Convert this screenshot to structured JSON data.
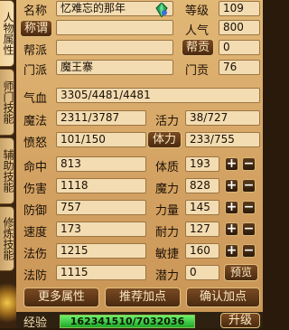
{
  "tabs": [
    "人物属性",
    "师门技能",
    "辅助技能",
    "修炼技能"
  ],
  "profile": {
    "name_label": "名称",
    "name_value": "忆难忘的那年",
    "level_label": "等级",
    "level_value": "109",
    "title_button": "称谓",
    "popularity_label": "人气",
    "popularity_value": "800",
    "guild_label": "帮派",
    "guild_value": "",
    "guild_contrib_button": "帮贡",
    "guild_contrib_value": "0",
    "sect_label": "门派",
    "sect_value": "魔王寨",
    "sect_contrib_label": "门贡",
    "sect_contrib_value": "76"
  },
  "vitals": {
    "hp_label": "气血",
    "hp_value": "3305/4481/4481",
    "mp_label": "魔法",
    "mp_value": "2311/3787",
    "vitality_label": "活力",
    "vitality_value": "38/727",
    "rage_label": "愤怒",
    "rage_value": "101/150",
    "stamina_button": "体力",
    "stamina_value": "233/755"
  },
  "combat": [
    {
      "label": "命中",
      "value": "813"
    },
    {
      "label": "伤害",
      "value": "1118"
    },
    {
      "label": "防御",
      "value": "757"
    },
    {
      "label": "速度",
      "value": "173"
    },
    {
      "label": "法伤",
      "value": "1215"
    },
    {
      "label": "法防",
      "value": "1115"
    }
  ],
  "attributes": [
    {
      "label": "体质",
      "value": "193"
    },
    {
      "label": "魔力",
      "value": "828"
    },
    {
      "label": "力量",
      "value": "145"
    },
    {
      "label": "耐力",
      "value": "127"
    },
    {
      "label": "敏捷",
      "value": "160"
    }
  ],
  "potential": {
    "label": "潜力",
    "value": "0",
    "preview_button": "预览"
  },
  "actions": {
    "more_attrs": "更多属性",
    "recommend_points": "推荐加点",
    "confirm_points": "确认加点"
  },
  "experience": {
    "label": "经验",
    "value": "162341510/7032036",
    "upgrade_button": "升级",
    "fill_fraction": 1.0
  },
  "colors": {
    "panel_bg": "#d3a262",
    "field_bg": "#f3dcb1",
    "button_bg": "#4a2a10",
    "button_text": "#fbe9c4",
    "exp_fill": "#1ea82c"
  },
  "icons": {
    "gem": "green-gem-icon",
    "plus": "plus-icon",
    "minus": "minus-icon"
  }
}
